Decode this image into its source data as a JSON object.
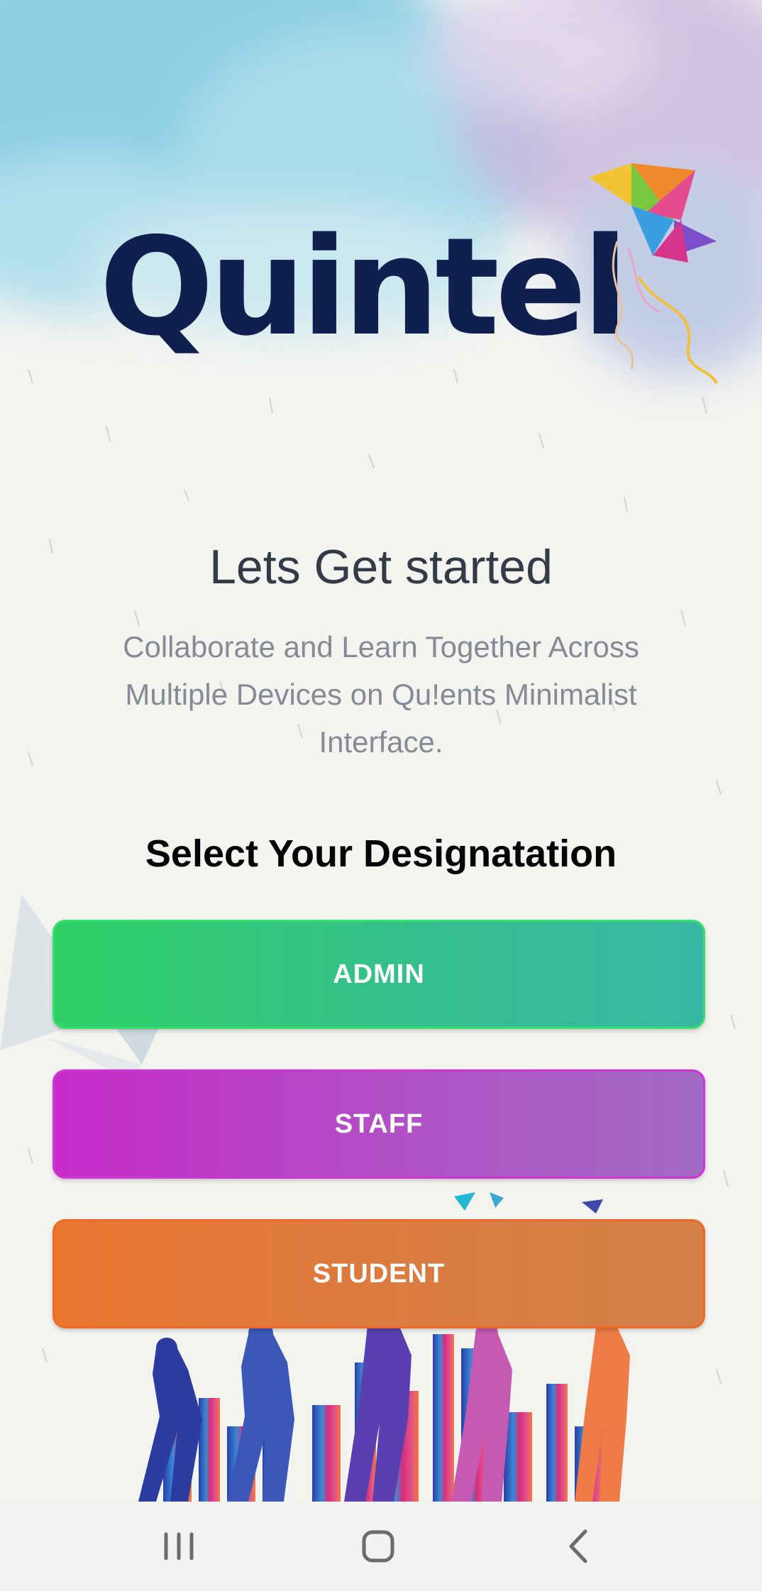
{
  "app": {
    "logo_text": "Quintel"
  },
  "intro": {
    "headline": "Lets Get started",
    "subtitle": "Collaborate and Learn Together Across Multiple Devices on Qu!ents Minimalist Interface."
  },
  "designation": {
    "title": "Select Your Designatation",
    "buttons": {
      "admin": "ADMIN",
      "staff": "STAFF",
      "student": "STUDENT"
    }
  },
  "colors": {
    "admin": "#2fd066",
    "staff": "#c62ac8",
    "student": "#ea7630",
    "logo": "#0f1f4f"
  },
  "navigation": {
    "recents_icon": "recent-apps-icon",
    "home_icon": "home-icon",
    "back_icon": "back-icon"
  }
}
